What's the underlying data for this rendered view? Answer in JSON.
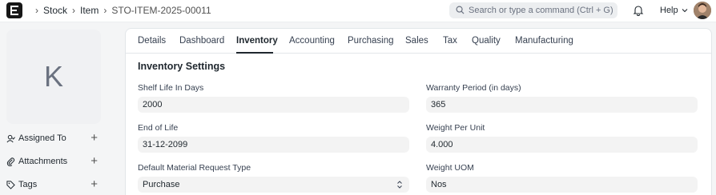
{
  "nav": {
    "breadcrumbs": [
      "Stock",
      "Item",
      "STO-ITEM-2025-00011"
    ],
    "search_placeholder": "Search or type a command (Ctrl + G)",
    "help_label": "Help"
  },
  "sidebar": {
    "image_letter": "K",
    "items": [
      {
        "label": "Assigned To",
        "icon": "user-check-icon"
      },
      {
        "label": "Attachments",
        "icon": "paperclip-icon"
      },
      {
        "label": "Tags",
        "icon": "tag-icon"
      }
    ]
  },
  "tabs": [
    "Details",
    "Dashboard",
    "Inventory",
    "Accounting",
    "Purchasing",
    "Sales",
    "Tax",
    "Quality",
    "Manufacturing"
  ],
  "active_tab": "Inventory",
  "section": {
    "title": "Inventory Settings",
    "fields": [
      {
        "label": "Shelf Life In Days",
        "value": "2000"
      },
      {
        "label": "Warranty Period (in days)",
        "value": "365"
      },
      {
        "label": "End of Life",
        "value": "31-12-2099"
      },
      {
        "label": "Weight Per Unit",
        "value": "4.000"
      },
      {
        "label": "Default Material Request Type",
        "value": "Purchase"
      },
      {
        "label": "Weight UOM",
        "value": "Nos"
      }
    ]
  }
}
